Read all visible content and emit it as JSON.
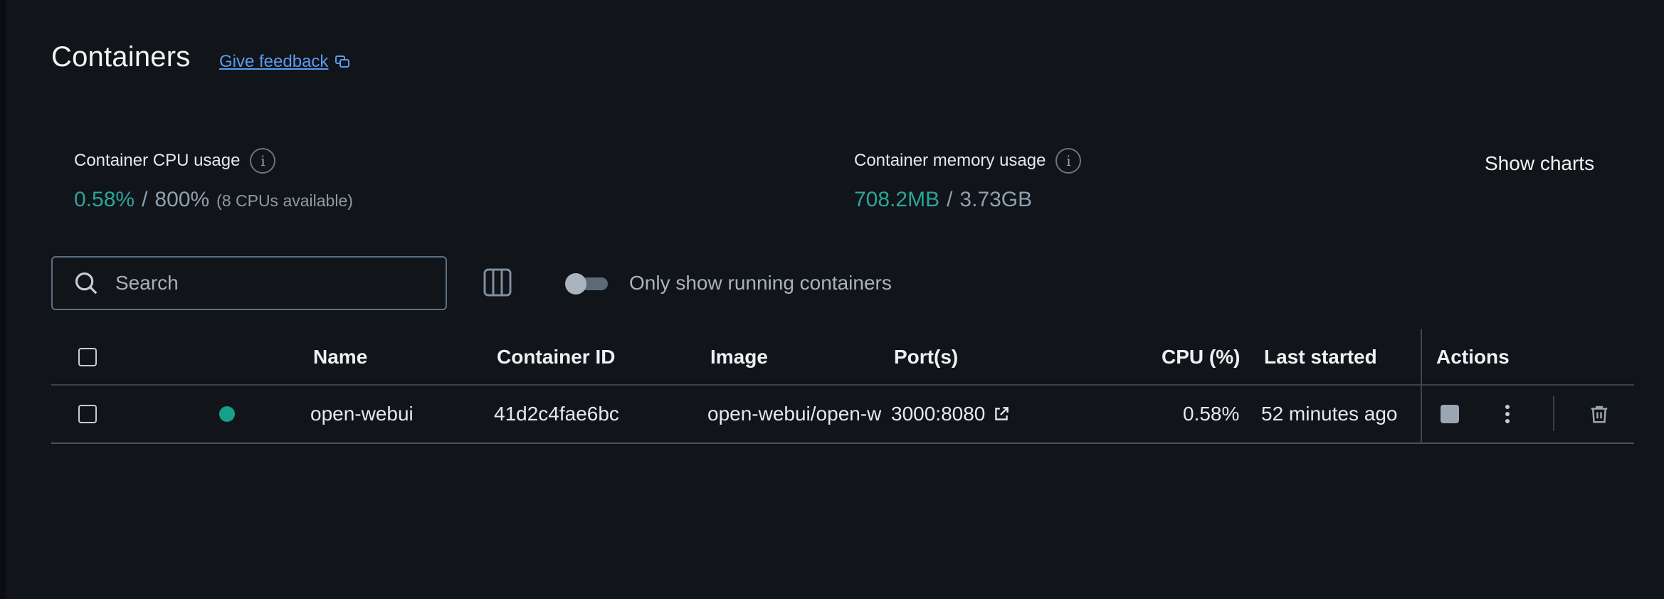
{
  "header": {
    "title": "Containers",
    "feedback_label": "Give feedback"
  },
  "stats": {
    "cpu": {
      "label": "Container CPU usage",
      "value": "0.58%",
      "separator": "/",
      "total": "800%",
      "note": "(8 CPUs available)"
    },
    "memory": {
      "label": "Container memory usage",
      "value": "708.2MB",
      "separator": "/",
      "total": "3.73GB"
    },
    "show_charts_label": "Show charts"
  },
  "toolbar": {
    "search_placeholder": "Search",
    "running_toggle_label": "Only show running containers",
    "running_toggle_on": false
  },
  "table": {
    "columns": {
      "name": "Name",
      "container_id": "Container ID",
      "image": "Image",
      "ports": "Port(s)",
      "cpu": "CPU (%)",
      "last_started": "Last started",
      "actions": "Actions"
    },
    "rows": [
      {
        "status": "running",
        "name": "open-webui",
        "container_id": "41d2c4fae6bc",
        "image": "open-webui/open-webui",
        "ports": "3000:8080",
        "cpu": "0.58%",
        "last_started": "52 minutes ago"
      }
    ]
  },
  "colors": {
    "background": "#111418",
    "accent_link": "#5b9bf2",
    "usage_green": "#2ba59a",
    "status_running": "#16a089"
  },
  "icons": [
    "feedback-icon",
    "info-icon",
    "search-icon",
    "columns-icon",
    "external-link-icon",
    "stop-icon",
    "more-vertical-icon",
    "trash-icon"
  ]
}
